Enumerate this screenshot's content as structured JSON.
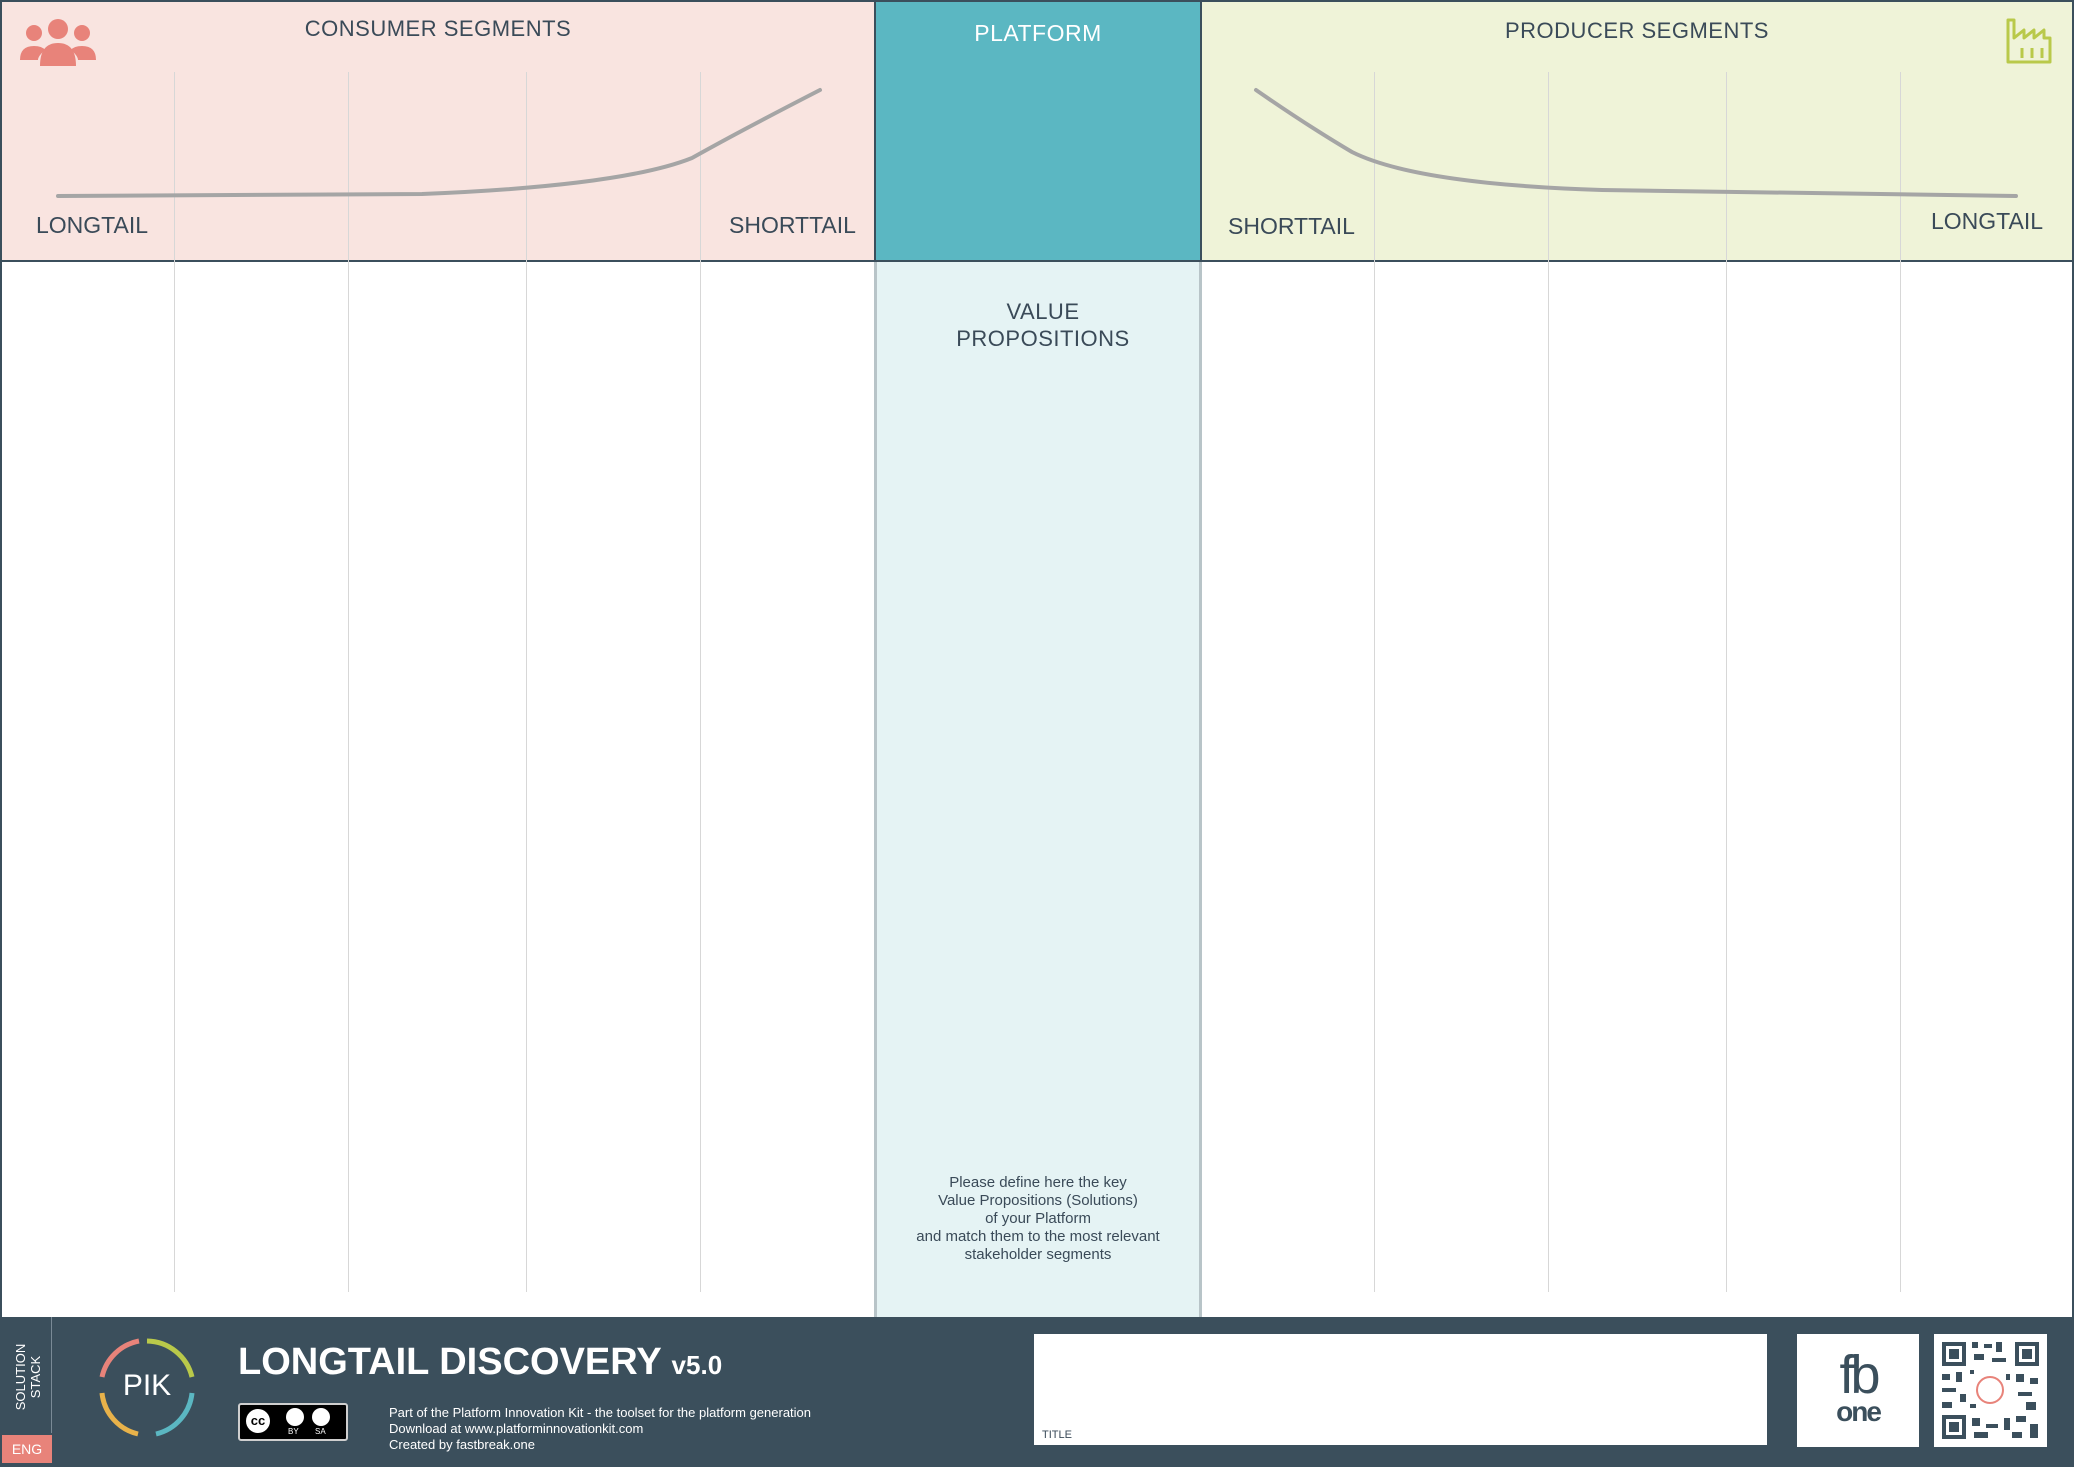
{
  "consumer": {
    "title": "CONSUMER SEGMENTS",
    "left_label": "LONGTAIL",
    "right_label": "SHORTTAIL",
    "icon": "users-icon",
    "bg": "#f9e4e0",
    "accent": "#e8837a"
  },
  "platform": {
    "title": "PLATFORM",
    "bg": "#5bb7c2",
    "value_title_line1": "VALUE",
    "value_title_line2": "PROPOSITIONS",
    "value_bg": "#e5f3f4",
    "instructions": [
      "Please define here the key",
      "Value Propositions (Solutions)",
      "of your Platform",
      "and match them to the most relevant",
      "stakeholder segments"
    ]
  },
  "producer": {
    "title": "PRODUCER SEGMENTS",
    "left_label": "SHORTTAIL",
    "right_label": "LONGTAIL",
    "icon": "factory-icon",
    "bg": "#eff3d8",
    "accent": "#b9c94a"
  },
  "footer": {
    "bg": "#3b4f5c",
    "side_label_line1": "SOLUTION",
    "side_label_line2": "STACK",
    "lang_badge": "ENG",
    "lang_badge_color": "#e8837a",
    "pik_logo_text": "PIK",
    "title": "LONGTAIL DISCOVERY",
    "version": "v5.0",
    "license": {
      "cc": "cc",
      "by": "BY",
      "sa": "SA"
    },
    "credits": [
      "Part of the Platform Innovation Kit  - the toolset for the platform generation",
      "Download at www.platforminnovationkit.com",
      "Created by fastbreak.one"
    ],
    "title_field_label": "TITLE",
    "fb_logo_top": "fb",
    "fb_logo_bottom": "one"
  }
}
